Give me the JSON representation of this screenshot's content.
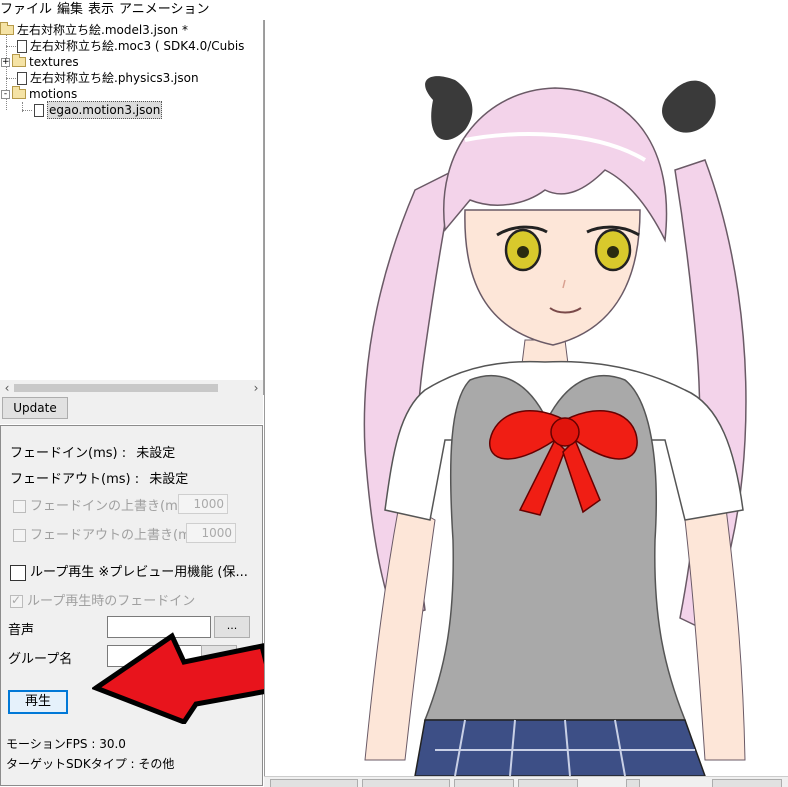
{
  "menubar": {
    "items": [
      "ファイル",
      "編集",
      "表示",
      "アニメーション"
    ]
  },
  "tree": {
    "items": [
      {
        "label": "左右対称立ち絵.model3.json *",
        "icon": "folder-open-icon"
      },
      {
        "label": "左右対称立ち絵.moc3 ( SDK4.0/Cubis",
        "icon": "file-icon"
      },
      {
        "label": "textures",
        "icon": "folder-icon",
        "expander": "+"
      },
      {
        "label": "左右対称立ち絵.physics3.json",
        "icon": "file-icon"
      },
      {
        "label": "motions",
        "icon": "folder-open-icon",
        "expander": "-"
      },
      {
        "label": "egao.motion3.json",
        "icon": "file-icon",
        "selected": true
      }
    ]
  },
  "update_button": "Update",
  "props": {
    "fade_in_label": "フェードイン(ms) :",
    "fade_in_value": "未設定",
    "fade_out_label": "フェードアウト(ms) :",
    "fade_out_value": "未設定",
    "override_fade_in": "フェードインの上書き(ms)",
    "override_fade_in_value": "1000",
    "override_fade_out": "フェードアウトの上書き(ms)",
    "override_fade_out_value": "1000",
    "loop_play": "ループ再生 ※プレビュー用機能 (保...",
    "loop_fade_in": "ループ再生時のフェードイン",
    "sound_label": "音声",
    "group_label": "グループ名",
    "browse_button": "...",
    "play_button": "再生",
    "motion_fps": "モーションFPS : 30.0",
    "target_sdk": "ターゲットSDKタイプ : その他"
  },
  "colors": {
    "arrow": "#e8141c",
    "hair": "#f3d3ea",
    "ribbon_black": "#3a3a3a",
    "vest": "#a9a9a9",
    "bow": "#f01e14",
    "skirt": "#3d4f86",
    "eyes": "#d8c92c"
  }
}
